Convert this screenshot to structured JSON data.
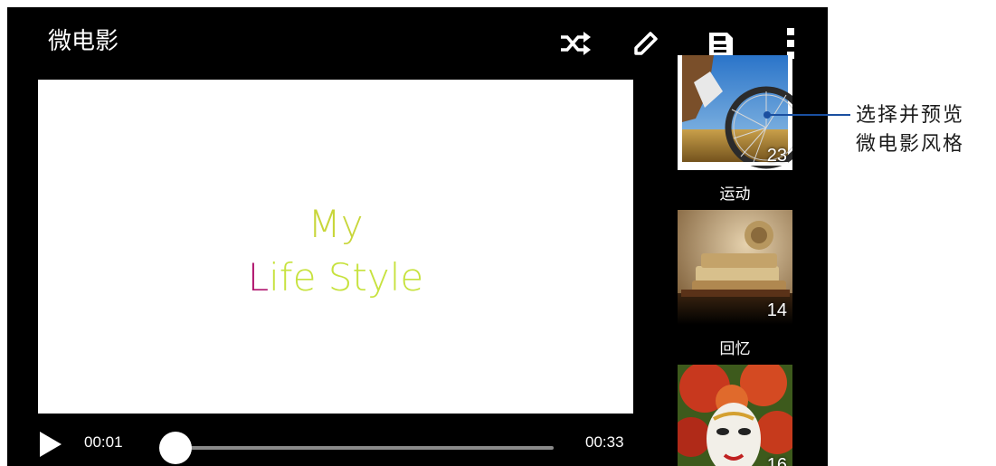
{
  "app": {
    "title": "微电影"
  },
  "actions": [
    {
      "name": "shuffle-icon"
    },
    {
      "name": "edit-icon"
    },
    {
      "name": "save-icon"
    },
    {
      "name": "more-options-icon"
    }
  ],
  "video": {
    "line1": "My",
    "line2_first": "L",
    "line2_rest": "ife Style"
  },
  "player": {
    "current_time": "00:01",
    "total_time": "00:33",
    "progress": 0.03
  },
  "styles": [
    {
      "label": "运动",
      "count": "23"
    },
    {
      "label": "回忆",
      "count": "14"
    },
    {
      "label": "",
      "count": "16"
    }
  ],
  "callout": {
    "line1": "选择并预览",
    "line2": "微电影风格"
  },
  "colors": {
    "bar": "#000000",
    "callout": "#1a4fa0",
    "title_green": "#c7e23e",
    "title_magenta": "#b0156e"
  }
}
